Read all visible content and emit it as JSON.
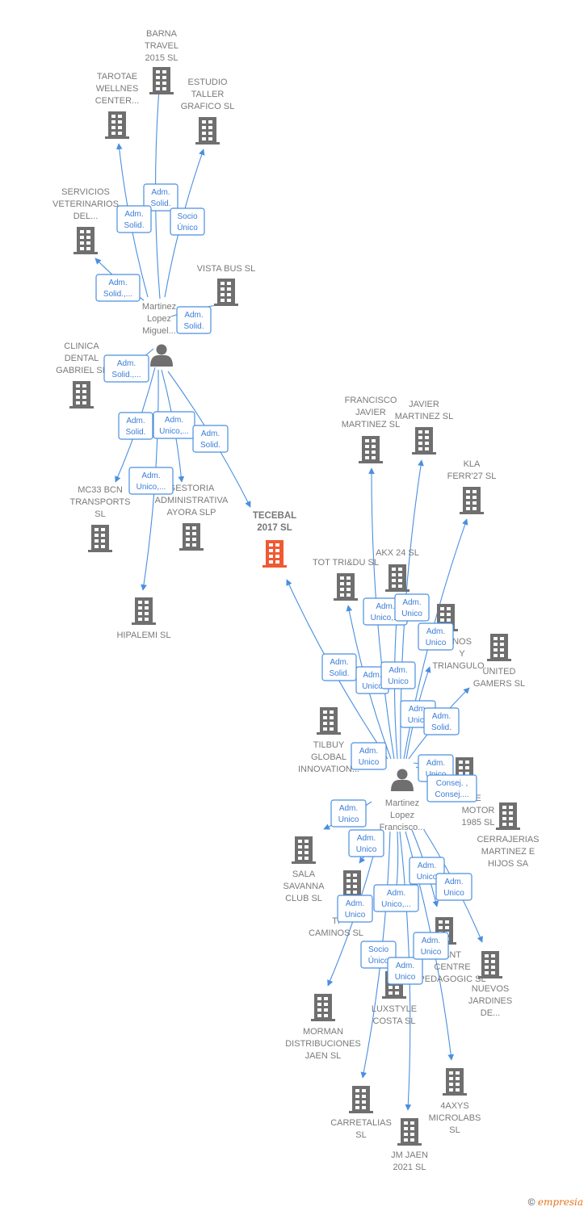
{
  "colors": {
    "edge": "#4a8fe0",
    "company": "#6f6f6f",
    "highlight": "#f05a32",
    "person": "#6f6f6f"
  },
  "persons": [
    {
      "id": "p1",
      "label": [
        "Martinez",
        "Lopez",
        "Miguel..."
      ]
    },
    {
      "id": "p2",
      "label": [
        "Martinez",
        "Lopez",
        "Francisco..."
      ]
    }
  ],
  "companies": [
    {
      "id": "barna",
      "label": [
        "BARNA",
        "TRAVEL",
        "2015  SL"
      ]
    },
    {
      "id": "tarotae",
      "label": [
        "TAROTAE",
        "WELLNES",
        "CENTER..."
      ]
    },
    {
      "id": "estudio",
      "label": [
        "ESTUDIO",
        "TALLER",
        "GRAFICO SL"
      ]
    },
    {
      "id": "servicios",
      "label": [
        "SERVICIOS",
        "VETERINARIOS",
        "DEL..."
      ]
    },
    {
      "id": "vista",
      "label": [
        "VISTA BUS  SL"
      ]
    },
    {
      "id": "clinica",
      "label": [
        "CLINICA",
        "DENTAL",
        "GABRIEL  SL"
      ]
    },
    {
      "id": "mc33",
      "label": [
        "MC33 BCN",
        "TRANSPORTS",
        "SL"
      ]
    },
    {
      "id": "gestoria",
      "label": [
        "GESTORIA",
        "ADMINISTRATIVA",
        "AYORA  SLP"
      ]
    },
    {
      "id": "hipalemi",
      "label": [
        "HIPALEMI  SL"
      ]
    },
    {
      "id": "tecebal",
      "label": [
        "TECEBAL",
        "2017  SL"
      ],
      "highlight": true
    },
    {
      "id": "francisco",
      "label": [
        "FRANCISCO",
        "JAVIER",
        "MARTINEZ  SL"
      ]
    },
    {
      "id": "javier",
      "label": [
        "JAVIER",
        "MARTINEZ  SL"
      ]
    },
    {
      "id": "kla",
      "label": [
        "KLA",
        "FERR'27  SL"
      ]
    },
    {
      "id": "akx",
      "label": [
        "AKX 24  SL"
      ]
    },
    {
      "id": "tot",
      "label": [
        "TOT TRI&DU SL"
      ]
    },
    {
      "id": "triangulo",
      "label": [
        "NOS",
        "Y",
        "TRIANGULO..."
      ]
    },
    {
      "id": "united",
      "label": [
        "UNITED",
        "GAMERS  SL"
      ]
    },
    {
      "id": "tilbuy",
      "label": [
        "TILBUY",
        "GLOBAL",
        "INNOVATION..."
      ]
    },
    {
      "id": "motor",
      "label": [
        "E",
        "MOTOR",
        "1985  SL"
      ]
    },
    {
      "id": "cerrajerias",
      "label": [
        "CERRAJERIAS",
        "MARTINEZ E",
        "HIJOS SA"
      ]
    },
    {
      "id": "sala",
      "label": [
        "SALA",
        "SAVANNA",
        "CLUB  SL"
      ]
    },
    {
      "id": "caminos",
      "label": [
        "TI",
        "CAMINOS  SL"
      ]
    },
    {
      "id": "centre",
      "label": [
        "ANT",
        "CENTRE",
        "PEDAGOGIC SL"
      ]
    },
    {
      "id": "nuevos",
      "label": [
        "NUEVOS",
        "JARDINES",
        "DE..."
      ]
    },
    {
      "id": "luxstyle",
      "label": [
        "LUXSTYLE",
        "COSTA SL"
      ]
    },
    {
      "id": "morman",
      "label": [
        "MORMAN",
        "DISTRIBUCIONES",
        "JAEN  SL"
      ]
    },
    {
      "id": "carretalias",
      "label": [
        "CARRETALIAS",
        "SL"
      ]
    },
    {
      "id": "jmjaen",
      "label": [
        "JM JAEN",
        "2021  SL"
      ]
    },
    {
      "id": "axys",
      "label": [
        "4AXYS",
        "MICROLABS",
        "SL"
      ]
    }
  ],
  "edges": [
    {
      "from": "p1",
      "to": "barna",
      "label": [
        "Adm.",
        "Solid."
      ]
    },
    {
      "from": "p1",
      "to": "tarotae",
      "label": [
        "Adm.",
        "Solid."
      ]
    },
    {
      "from": "p1",
      "to": "estudio",
      "label": [
        "Socio",
        "Único"
      ]
    },
    {
      "from": "p1",
      "to": "servicios",
      "label": [
        "Adm.",
        "Solid.,..."
      ]
    },
    {
      "from": "p1",
      "to": "vista",
      "label": [
        "Adm.",
        "Solid."
      ]
    },
    {
      "from": "p1",
      "to": "clinica",
      "label": [
        "Adm.",
        "Solid.,..."
      ]
    },
    {
      "from": "p1",
      "to": "mc33",
      "label": [
        "Adm.",
        "Solid."
      ]
    },
    {
      "from": "p1",
      "to": "gestoria",
      "label": [
        "Adm.",
        "Unico,..."
      ]
    },
    {
      "from": "p1",
      "to": "tecebal",
      "label": [
        "Adm.",
        "Solid."
      ]
    },
    {
      "from": "p1",
      "to": "hipalemi",
      "label": [
        "Adm.",
        "Unico,..."
      ]
    },
    {
      "from": "p2",
      "to": "tecebal",
      "label": [
        "Adm.",
        "Solid."
      ]
    },
    {
      "from": "p2",
      "to": "tot",
      "label": [
        "Adm.",
        "Unico"
      ]
    },
    {
      "from": "p2",
      "to": "francisco",
      "label": [
        "Adm.",
        "Unico,..."
      ]
    },
    {
      "from": "p2",
      "to": "akx",
      "label": [
        "Adm.",
        "Unico"
      ]
    },
    {
      "from": "p2",
      "to": "javier",
      "label": [
        "Adm.",
        "Unico"
      ]
    },
    {
      "from": "p2",
      "to": "kla",
      "label": [
        "Adm.",
        "Unico"
      ]
    },
    {
      "from": "p2",
      "to": "triangulo",
      "label": [
        "Adm.",
        "Unico"
      ]
    },
    {
      "from": "p2",
      "to": "united",
      "label": [
        "Adm.",
        "Solid."
      ]
    },
    {
      "from": "p2",
      "to": "tilbuy",
      "label": [
        "Adm.",
        "Unico"
      ]
    },
    {
      "from": "p2",
      "to": "motor",
      "label": [
        "Adm.",
        "Unico"
      ]
    },
    {
      "from": "p2",
      "to": "cerrajerias",
      "label": [
        "Consej. ,",
        "Consej...."
      ]
    },
    {
      "from": "p2",
      "to": "sala",
      "label": [
        "Adm.",
        "Unico"
      ]
    },
    {
      "from": "p2",
      "to": "caminos",
      "label": [
        "Adm.",
        "Unico"
      ]
    },
    {
      "from": "p2",
      "to": "centre",
      "label": [
        "Adm.",
        "Unico"
      ]
    },
    {
      "from": "p2",
      "to": "nuevos",
      "label": [
        "Adm.",
        "Unico"
      ]
    },
    {
      "from": "p2",
      "to": "luxstyle",
      "label": [
        "Adm.",
        "Unico,..."
      ]
    },
    {
      "from": "p2",
      "to": "morman",
      "label": [
        "Adm.",
        "Unico"
      ]
    },
    {
      "from": "p2",
      "to": "carretalias",
      "label": [
        "Socio",
        "Único"
      ]
    },
    {
      "from": "p2",
      "to": "jmjaen",
      "label": [
        "Adm.",
        "Unico"
      ]
    },
    {
      "from": "p2",
      "to": "axys",
      "label": [
        "Adm.",
        "Unico"
      ]
    }
  ],
  "footer": {
    "copyright": "©",
    "brand": "empresia"
  }
}
